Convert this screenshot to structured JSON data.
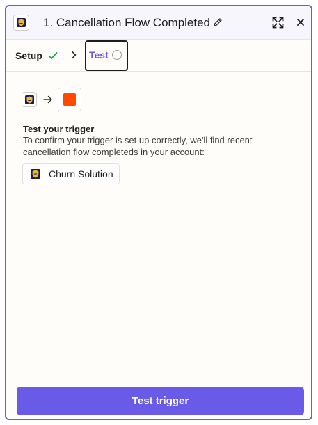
{
  "header": {
    "title": "1. Cancellation Flow Completed",
    "app_icon": "churn-solution-shield-logo",
    "actions": [
      "pencil-icon",
      "expand-icon",
      "close-icon"
    ]
  },
  "tabs": [
    {
      "label": "Setup",
      "status_icon": "check-icon",
      "status_color": "#1b9e4b"
    },
    {
      "label": "Test",
      "status_icon": "circle-icon",
      "active": true,
      "color": "#695be8"
    }
  ],
  "content": {
    "flow_icons": [
      "churn-solution-shield-logo",
      "arrow-right-icon",
      "orange-square-app-icon"
    ],
    "title": "Test your trigger",
    "description": "To confirm your trigger is set up correctly, we'll find recent cancellation flow completeds in your account:",
    "account_chip": {
      "label": "Churn Solution",
      "icon": "churn-solution-shield-logo"
    }
  },
  "footer": {
    "button_label": "Test trigger"
  },
  "colors": {
    "accent": "#695be8",
    "action_app": "#ff4a00",
    "brand_logo": "#1e1c48",
    "logo_gold": "#f2b632"
  }
}
